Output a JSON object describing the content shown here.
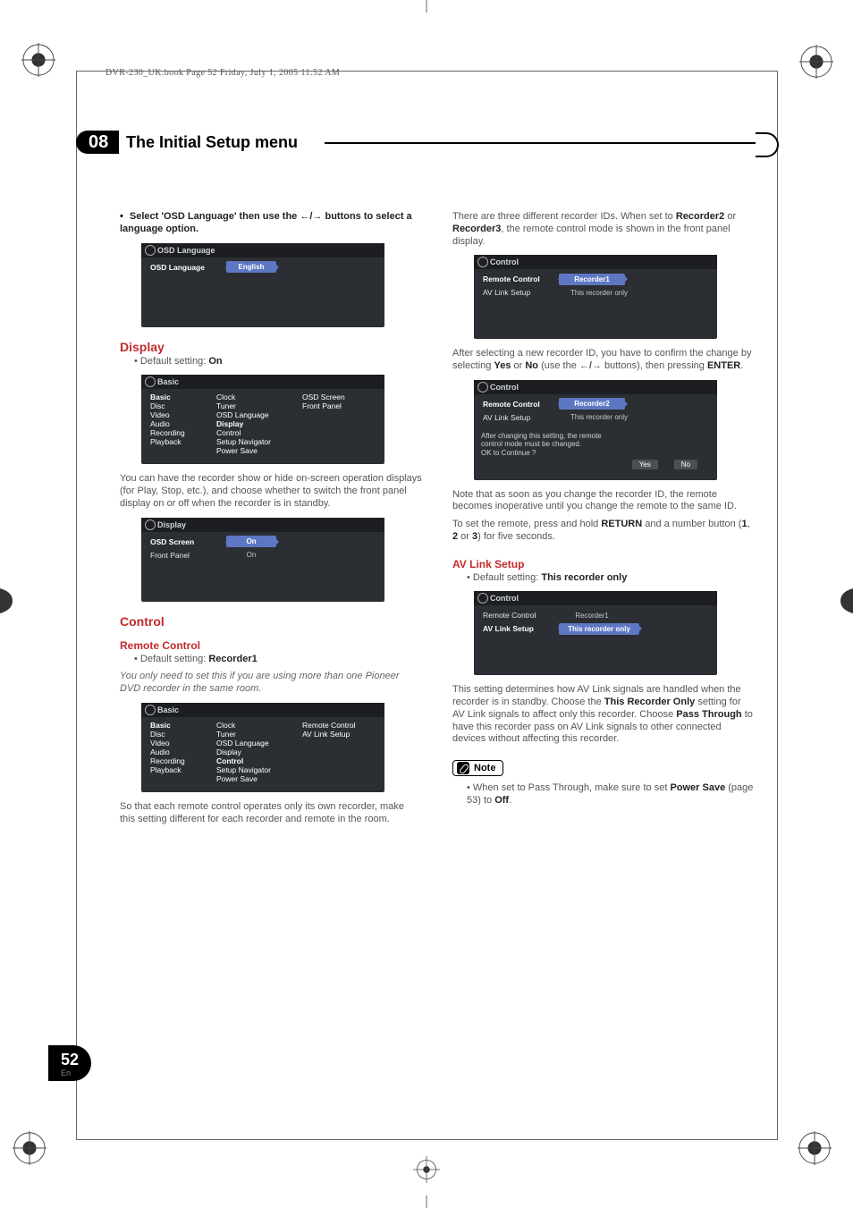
{
  "bookline": "DVR-230_UK.book  Page 52  Friday, July 1, 2005  11:52 AM",
  "chapter": {
    "num": "08",
    "title": "The Initial Setup menu"
  },
  "pagenum": {
    "n": "52",
    "lang": "En"
  },
  "left": {
    "lead1_pre": "Select 'OSD Language' then use the ",
    "lead1_post": " buttons to select a language option.",
    "osd_lang": {
      "title": "OSD Language",
      "label": "OSD Language",
      "value": "English"
    },
    "display": {
      "heading": "Display",
      "default_label": "Default setting: ",
      "default_value": "On",
      "panel": {
        "title": "Basic",
        "col1": [
          "Basic",
          "Disc",
          "Video",
          "Audio",
          "Recording",
          "Playback"
        ],
        "col2": [
          "Clock",
          "Tuner",
          "OSD Language",
          "Display",
          "Control",
          "Setup Navigator",
          "Power Save"
        ],
        "col3": [
          "OSD Screen",
          "Front Panel"
        ]
      },
      "para": "You can have the recorder show or hide on-screen operation displays (for Play, Stop, etc.), and choose whether to switch the front panel display on or off when the recorder is in standby.",
      "panel2": {
        "title": "Display",
        "rows": [
          {
            "label": "OSD Screen",
            "value": "On",
            "sel": true
          },
          {
            "label": "Front Panel",
            "value": "On",
            "sel": false
          }
        ]
      }
    },
    "control": {
      "heading": "Control",
      "sub": "Remote Control",
      "default_label": "Default setting: ",
      "default_value": "Recorder1",
      "italic": "You only need to set this if you are using more than one Pioneer DVD recorder in the same room.",
      "panel": {
        "title": "Basic",
        "col1": [
          "Basic",
          "Disc",
          "Video",
          "Audio",
          "Recording",
          "Playback"
        ],
        "col2": [
          "Clock",
          "Tuner",
          "OSD Language",
          "Display",
          "Control",
          "Setup Navigator",
          "Power Save"
        ],
        "col3": [
          "Remote Control",
          "AV Link Setup"
        ]
      },
      "para": "So that each remote control operates only its own recorder, make this setting different for each recorder and remote in the room."
    }
  },
  "right": {
    "intro_a": "There are three different recorder IDs. When set to ",
    "intro_b": " or ",
    "intro_c": ", the remote control mode is shown in the front panel display.",
    "rec2": "Recorder2",
    "rec3": "Recorder3",
    "panel1": {
      "title": "Control",
      "rows": [
        {
          "label": "Remote Control",
          "value": "Recorder1",
          "sel": true
        },
        {
          "label": "AV Link Setup",
          "value": "This recorder only",
          "sel": false
        }
      ]
    },
    "after_a": "After selecting a new recorder ID, you have to confirm the change by selecting ",
    "yes": "Yes",
    "or": " or ",
    "no": "No",
    "after_b": " (use the ",
    "after_c": " buttons), then pressing ",
    "enter": "ENTER",
    "panel2": {
      "title": "Control",
      "rows": [
        {
          "label": "Remote Control",
          "value": "Recorder2",
          "sel": true
        },
        {
          "label": "AV Link Setup",
          "value": "This recorder only",
          "sel": false
        }
      ],
      "msg1": "After changing this setting, the remote",
      "msg2": "control mode must be changed.",
      "msg3": "OK to Continue ?",
      "yes": "Yes",
      "no": "No"
    },
    "note_para": "Note that as soon as you change the recorder ID, the remote becomes inoperative until you change the remote to the same ID.",
    "set_a": "To set the remote, press and hold ",
    "return": "RETURN",
    "set_b": " and a number button (",
    "n1": "1",
    "c1": ", ",
    "n2": "2",
    "c2": " or ",
    "n3": "3",
    "set_c": ") for five seconds.",
    "avlink": {
      "heading": "AV Link Setup",
      "default_label": "Default setting: ",
      "default_value": "This recorder only",
      "panel": {
        "title": "Control",
        "rows": [
          {
            "label": "Remote Control",
            "value": "Recorder1",
            "sel": false
          },
          {
            "label": "AV Link Setup",
            "value": "This recorder only",
            "sel": true
          }
        ]
      },
      "para_a": "This setting determines how AV Link signals are handled when the recorder is in standby. Choose the ",
      "thisrec": "This Recorder Only",
      "para_b": " setting for AV Link signals to affect only this recorder. Choose ",
      "pass": "Pass Through",
      "para_c": " to have this recorder pass on AV Link signals to other connected devices without affecting this recorder."
    },
    "note": {
      "label": "Note",
      "text_a": "When set to Pass Through, make sure to set ",
      "power": "Power Save",
      "text_b": " (page 53) to ",
      "off": "Off",
      "dot": "."
    }
  }
}
